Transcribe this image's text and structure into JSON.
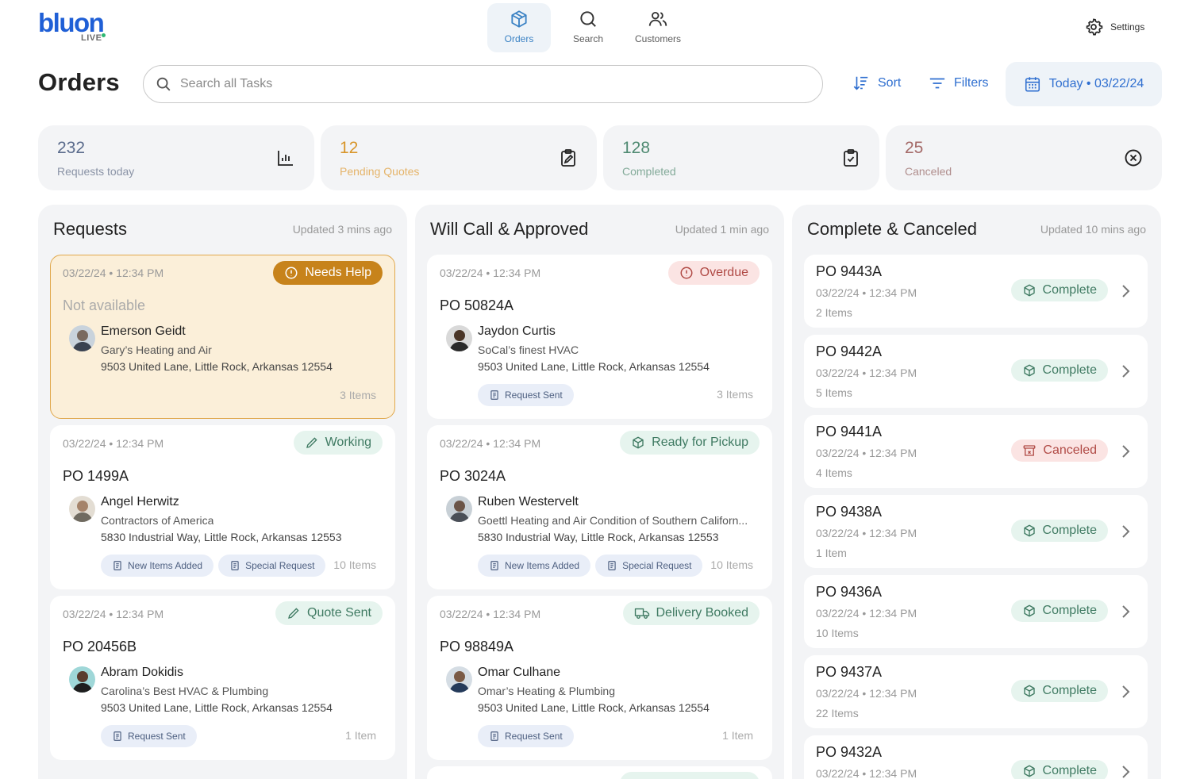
{
  "brand": {
    "name": "bluon",
    "sub": "LIVE"
  },
  "nav": [
    {
      "label": "Orders",
      "icon": "box-icon",
      "active": true
    },
    {
      "label": "Search",
      "icon": "search-icon"
    },
    {
      "label": "Customers",
      "icon": "users-icon"
    }
  ],
  "settings": {
    "label": "Settings",
    "icon": "gear-icon"
  },
  "page_title": "Orders",
  "search": {
    "placeholder": "Search all Tasks"
  },
  "toolbar": {
    "sort": "Sort",
    "filters": "Filters",
    "date": "Today • 03/22/24"
  },
  "stats": [
    {
      "value": "232",
      "label": "Requests today",
      "color": "#5a6b8c",
      "icon": "bar-chart-icon"
    },
    {
      "value": "12",
      "label": "Pending Quotes",
      "color": "#d8952a",
      "icon": "clipboard-pen-icon"
    },
    {
      "value": "128",
      "label": "Completed",
      "color": "#4f8a72",
      "icon": "clipboard-check-icon"
    },
    {
      "value": "25",
      "label": "Canceled",
      "color": "#a46a68",
      "icon": "x-circle-icon"
    }
  ],
  "columns": {
    "requests": {
      "title": "Requests",
      "updated": "Updated 3 mins ago",
      "cards": [
        {
          "timestamp": "03/22/24 • 12:34 PM",
          "badge": "Needs Help",
          "po": "Not available",
          "name": "Emerson Geidt",
          "company": "Gary’s Heating and Air",
          "address": "9503 United Lane, Little Rock, Arkansas 12554",
          "tags": [],
          "items": "3 Items"
        },
        {
          "timestamp": "03/22/24 • 12:34 PM",
          "badge": "Working",
          "po": "PO 1499A",
          "name": "Angel Herwitz",
          "company": "Contractors of America",
          "address": "5830 Industrial Way, Little Rock, Arkansas 12553",
          "tags": [
            "New Items Added",
            "Special Request"
          ],
          "items": "10 Items"
        },
        {
          "timestamp": "03/22/24 • 12:34 PM",
          "badge": "Quote Sent",
          "po": "PO 20456B",
          "name": "Abram Dokidis",
          "company": "Carolina’s Best HVAC & Plumbing",
          "address": "9503 United Lane, Little Rock, Arkansas 12554",
          "tags": [
            "Request Sent"
          ],
          "items": "1 Item"
        }
      ]
    },
    "willcall": {
      "title": "Will Call & Approved",
      "updated": "Updated 1 min ago",
      "cards": [
        {
          "timestamp": "03/22/24 • 12:34 PM",
          "badge": "Overdue",
          "po": "PO 50824A",
          "name": "Jaydon Curtis",
          "company": "SoCal’s finest HVAC",
          "address": "9503 United Lane, Little Rock, Arkansas 12554",
          "tags": [
            "Request Sent"
          ],
          "items": "3 Items"
        },
        {
          "timestamp": "03/22/24 • 12:34 PM",
          "badge": "Ready for Pickup",
          "po": "PO 3024A",
          "name": "Ruben Westervelt",
          "company": "Goettl Heating and Air Condition of Southern Californ...",
          "address": "5830 Industrial Way, Little Rock, Arkansas 12553",
          "tags": [
            "New Items Added",
            "Special Request"
          ],
          "items": "10 Items"
        },
        {
          "timestamp": "03/22/24 • 12:34 PM",
          "badge": "Delivery Booked",
          "po": "PO 98849A",
          "name": "Omar Culhane",
          "company": "Omar’s Heating & Plumbing",
          "address": "9503 United Lane, Little Rock, Arkansas 12554",
          "tags": [
            "Request Sent"
          ],
          "items": "1 Item"
        }
      ]
    },
    "complete": {
      "title": "Complete & Canceled",
      "updated": "Updated 10 mins ago",
      "cards": [
        {
          "po": "PO 9443A",
          "timestamp": "03/22/24 • 12:34 PM",
          "items": "2 Items",
          "status": "Complete"
        },
        {
          "po": "PO 9442A",
          "timestamp": "03/22/24 • 12:34 PM",
          "items": "5 Items",
          "status": "Complete"
        },
        {
          "po": "PO 9441A",
          "timestamp": "03/22/24 • 12:34 PM",
          "items": "4 Items",
          "status": "Canceled"
        },
        {
          "po": "PO 9438A",
          "timestamp": "03/22/24 • 12:34 PM",
          "items": "1 Item",
          "status": "Complete"
        },
        {
          "po": "PO 9436A",
          "timestamp": "03/22/24 • 12:34 PM",
          "items": "10 Items",
          "status": "Complete"
        },
        {
          "po": "PO 9437A",
          "timestamp": "03/22/24 • 12:34 PM",
          "items": "22 Items",
          "status": "Complete"
        },
        {
          "po": "PO 9432A",
          "timestamp": "03/22/24 • 12:34 PM",
          "items": "",
          "status": "Complete"
        }
      ]
    }
  },
  "colors": {
    "accent": "#2f6fd0",
    "help": "#d8952a",
    "complete_bg": "#e6f4ee",
    "complete_fg": "#3f7a62",
    "canceled_bg": "#fbe4e3",
    "canceled_fg": "#b04a45"
  }
}
